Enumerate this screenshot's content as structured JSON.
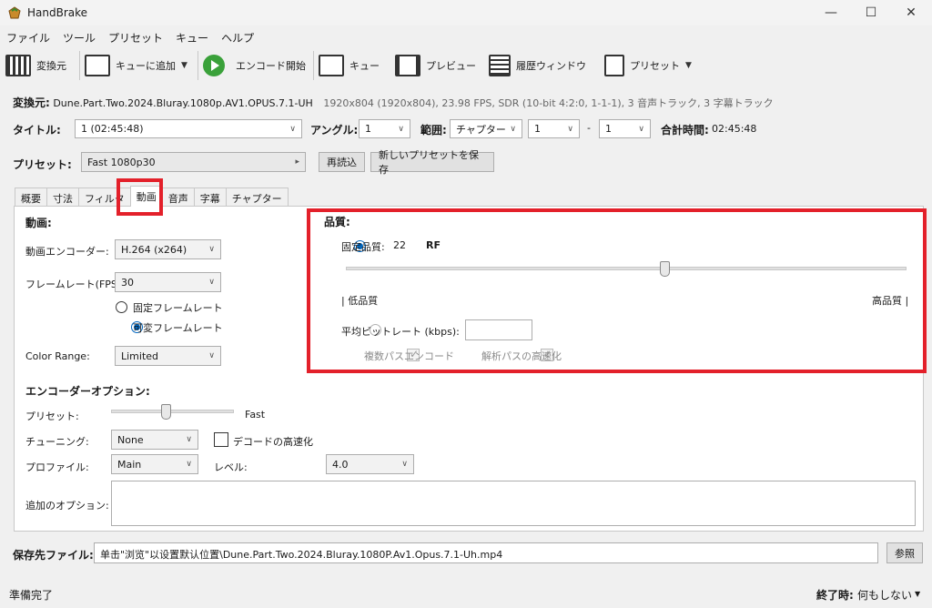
{
  "app": {
    "title": "HandBrake"
  },
  "menu": [
    "ファイル",
    "ツール",
    "プリセット",
    "キュー",
    "ヘルプ"
  ],
  "toolbar": {
    "source": "変換元",
    "add_queue": "キューに追加",
    "start": "エンコード開始",
    "queue": "キュー",
    "preview": "プレビュー",
    "activity": "履歴ウィンドウ",
    "presets": "プリセット"
  },
  "source": {
    "label": "変換元:",
    "name": "Dune.Part.Two.2024.Bluray.1080p.AV1.OPUS.7.1-UH",
    "info": "1920x804 (1920x804), 23.98 FPS, SDR (10-bit 4:2:0, 1-1-1), 3 音声トラック, 3 字幕トラック"
  },
  "title_row": {
    "title_label": "タイトル:",
    "title_value": "1 (02:45:48)",
    "angle_label": "アングル:",
    "angle_value": "1",
    "range_label": "範囲:",
    "range_type": "チャプター",
    "range_start": "1",
    "range_dash": "-",
    "range_end": "1",
    "duration_label": "合計時間:",
    "duration_value": "02:45:48"
  },
  "preset_row": {
    "label": "プリセット:",
    "value": "Fast 1080p30",
    "reload": "再読込",
    "save_new": "新しいプリセットを保存"
  },
  "tabs": [
    "概要",
    "寸法",
    "フィルタ",
    "動画",
    "音声",
    "字幕",
    "チャプター"
  ],
  "video": {
    "heading": "動画:",
    "encoder_label": "動画エンコーダー:",
    "encoder_value": "H.264 (x264)",
    "framerate_label": "フレームレート(FPS",
    "framerate_value": "30",
    "cfr": "固定フレームレート",
    "vfr": "可変フレームレート",
    "color_range_label": "Color Range:",
    "color_range_value": "Limited"
  },
  "quality": {
    "heading": "品質:",
    "cq_label": "固定品質:",
    "cq_value": "22",
    "rf": "RF",
    "slider_fraction": 0.57,
    "low": "| 低品質",
    "high": "高品質 |",
    "abr_label": "平均ビットレート (kbps):",
    "two_pass": "複数パスエンコード",
    "turbo": "解析パスの高速化"
  },
  "encoder_options": {
    "heading": "エンコーダーオプション:",
    "preset_label": "プリセット:",
    "preset_value": "Fast",
    "preset_fraction": 0.45,
    "tune_label": "チューニング:",
    "tune_value": "None",
    "fast_decode": "デコードの高速化",
    "profile_label": "プロファイル:",
    "profile_value": "Main",
    "level_label": "レベル:",
    "level_value": "4.0",
    "extra_label": "追加のオプション:"
  },
  "destination": {
    "label": "保存先ファイル:",
    "path": "单击\"浏览\"以设置默认位置\\Dune.Part.Two.2024.Bluray.1080P.Av1.Opus.7.1-Uh.mp4",
    "browse": "参照"
  },
  "status": {
    "left": "準備完了",
    "when_done_label": "終了時:",
    "when_done_value": "何もしない"
  },
  "colors": {
    "highlight": "#e3202a",
    "accent": "#0067c0",
    "play": "#3aa13a"
  }
}
